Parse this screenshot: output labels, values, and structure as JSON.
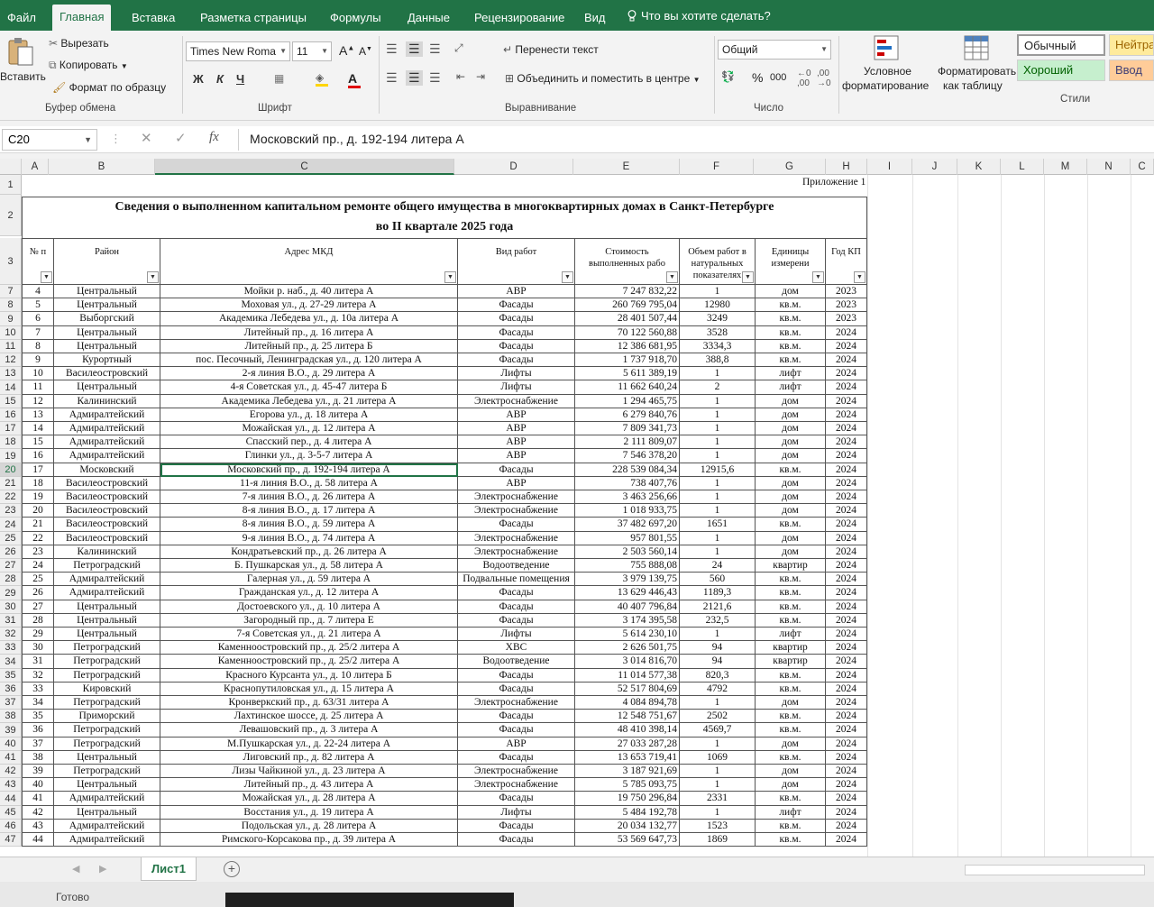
{
  "ribbon_tabs": {
    "file": "Файл",
    "home": "Главная",
    "insert": "Вставка",
    "layout": "Разметка страницы",
    "formulas": "Формулы",
    "data": "Данные",
    "review": "Рецензирование",
    "view": "Вид",
    "tellme": "Что вы хотите сделать?"
  },
  "clipboard": {
    "paste": "Вставить",
    "cut": "Вырезать",
    "copy": "Копировать",
    "format_painter": "Формат по образцу",
    "label": "Буфер обмена"
  },
  "font": {
    "name": "Times New Roma",
    "size": "11",
    "bold": "Ж",
    "italic": "К",
    "underline": "Ч",
    "label": "Шрифт"
  },
  "alignment": {
    "wrap": "Перенести текст",
    "merge": "Объединить и поместить в центре",
    "label": "Выравнивание"
  },
  "number": {
    "format": "Общий",
    "percent": "%",
    "thousands": "000",
    "label": "Число"
  },
  "styles": {
    "conditional": "Условное",
    "conditional2": "форматирование",
    "as_table": "Форматировать",
    "as_table2": "как таблицу",
    "normal": "Обычный",
    "neutral": "Нейтра",
    "good": "Хороший",
    "input": "Ввод",
    "label": "Стили"
  },
  "formula_bar": {
    "cell_ref": "C20",
    "fx": "fx",
    "value": "Московский пр., д. 192-194 литера А"
  },
  "columns": [
    "A",
    "B",
    "C",
    "D",
    "E",
    "F",
    "G",
    "H",
    "I",
    "J",
    "K",
    "L",
    "M",
    "N",
    "C"
  ],
  "sheet": {
    "appendix": "Приложение 1",
    "title_line1": "Сведения о выполненном капитальном ремонте общего имущества в многоквартирных домах в Санкт-Петербурге",
    "title_line2": "во II квартале 2025 года",
    "headers": {
      "num": "№ п",
      "district": "Район",
      "address": "Адрес МКД",
      "work": "Вид работ",
      "cost": "Стоимость выполненных рабо",
      "volume": "Объем работ в натуральных показателях",
      "units": "Единицы измерени",
      "year": "Год КП"
    },
    "rows": [
      {
        "r": "7",
        "n": "4",
        "district": "Центральный",
        "address": "Мойки р. наб., д. 40 литера А",
        "work": "АВР",
        "cost": "7 247 832,22",
        "volume": "1",
        "unit": "дом",
        "year": "2023"
      },
      {
        "r": "8",
        "n": "5",
        "district": "Центральный",
        "address": "Моховая ул., д. 27-29 литера А",
        "work": "Фасады",
        "cost": "260 769 795,04",
        "volume": "12980",
        "unit": "кв.м.",
        "year": "2023"
      },
      {
        "r": "9",
        "n": "6",
        "district": "Выборгский",
        "address": "Академика Лебедева ул., д. 10а литера А",
        "work": "Фасады",
        "cost": "28 401 507,44",
        "volume": "3249",
        "unit": "кв.м.",
        "year": "2023"
      },
      {
        "r": "10",
        "n": "7",
        "district": "Центральный",
        "address": "Литейный пр., д. 16 литера А",
        "work": "Фасады",
        "cost": "70 122 560,88",
        "volume": "3528",
        "unit": "кв.м.",
        "year": "2024"
      },
      {
        "r": "11",
        "n": "8",
        "district": "Центральный",
        "address": "Литейный пр., д. 25 литера Б",
        "work": "Фасады",
        "cost": "12 386 681,95",
        "volume": "3334,3",
        "unit": "кв.м.",
        "year": "2024"
      },
      {
        "r": "12",
        "n": "9",
        "district": "Курортный",
        "address": "пос. Песочный, Ленинградская ул., д. 120 литера А",
        "work": "Фасады",
        "cost": "1 737 918,70",
        "volume": "388,8",
        "unit": "кв.м.",
        "year": "2024"
      },
      {
        "r": "13",
        "n": "10",
        "district": "Василеостровский",
        "address": "2-я линия В.О., д. 29 литера А",
        "work": "Лифты",
        "cost": "5 611 389,19",
        "volume": "1",
        "unit": "лифт",
        "year": "2024"
      },
      {
        "r": "14",
        "n": "11",
        "district": "Центральный",
        "address": "4-я Советская ул., д. 45-47 литера Б",
        "work": "Лифты",
        "cost": "11 662 640,24",
        "volume": "2",
        "unit": "лифт",
        "year": "2024"
      },
      {
        "r": "15",
        "n": "12",
        "district": "Калининский",
        "address": "Академика Лебедева ул., д. 21 литера А",
        "work": "Электроснабжение",
        "cost": "1 294 465,75",
        "volume": "1",
        "unit": "дом",
        "year": "2024"
      },
      {
        "r": "16",
        "n": "13",
        "district": "Адмиралтейский",
        "address": "Егорова ул., д. 18 литера А",
        "work": "АВР",
        "cost": "6 279 840,76",
        "volume": "1",
        "unit": "дом",
        "year": "2024"
      },
      {
        "r": "17",
        "n": "14",
        "district": "Адмиралтейский",
        "address": "Можайская ул., д. 12 литера А",
        "work": "АВР",
        "cost": "7 809 341,73",
        "volume": "1",
        "unit": "дом",
        "year": "2024"
      },
      {
        "r": "18",
        "n": "15",
        "district": "Адмиралтейский",
        "address": "Спасский пер., д. 4 литера А",
        "work": "АВР",
        "cost": "2 111 809,07",
        "volume": "1",
        "unit": "дом",
        "year": "2024"
      },
      {
        "r": "19",
        "n": "16",
        "district": "Адмиралтейский",
        "address": "Глинки ул., д. 3-5-7 литера А",
        "work": "АВР",
        "cost": "7 546 378,20",
        "volume": "1",
        "unit": "дом",
        "year": "2024"
      },
      {
        "r": "20",
        "n": "17",
        "district": "Московский",
        "address": "Московский пр., д. 192-194 литера А",
        "work": "Фасады",
        "cost": "228 539 084,34",
        "volume": "12915,6",
        "unit": "кв.м.",
        "year": "2024"
      },
      {
        "r": "21",
        "n": "18",
        "district": "Василеостровский",
        "address": "11-я линия В.О., д. 58 литера А",
        "work": "АВР",
        "cost": "738 407,76",
        "volume": "1",
        "unit": "дом",
        "year": "2024"
      },
      {
        "r": "22",
        "n": "19",
        "district": "Василеостровский",
        "address": "7-я линия В.О., д. 26 литера А",
        "work": "Электроснабжение",
        "cost": "3 463 256,66",
        "volume": "1",
        "unit": "дом",
        "year": "2024"
      },
      {
        "r": "23",
        "n": "20",
        "district": "Василеостровский",
        "address": "8-я линия В.О., д. 17 литера А",
        "work": "Электроснабжение",
        "cost": "1 018 933,75",
        "volume": "1",
        "unit": "дом",
        "year": "2024"
      },
      {
        "r": "24",
        "n": "21",
        "district": "Василеостровский",
        "address": "8-я линия В.О., д. 59 литера А",
        "work": "Фасады",
        "cost": "37 482 697,20",
        "volume": "1651",
        "unit": "кв.м.",
        "year": "2024"
      },
      {
        "r": "25",
        "n": "22",
        "district": "Василеостровский",
        "address": "9-я линия В.О., д. 74 литера А",
        "work": "Электроснабжение",
        "cost": "957 801,55",
        "volume": "1",
        "unit": "дом",
        "year": "2024"
      },
      {
        "r": "26",
        "n": "23",
        "district": "Калининский",
        "address": "Кондратьевский пр., д. 26 литера А",
        "work": "Электроснабжение",
        "cost": "2 503 560,14",
        "volume": "1",
        "unit": "дом",
        "year": "2024"
      },
      {
        "r": "27",
        "n": "24",
        "district": "Петроградский",
        "address": "Б. Пушкарская ул., д. 58 литера А",
        "work": "Водоотведение",
        "cost": "755 888,08",
        "volume": "24",
        "unit": "квартир",
        "year": "2024"
      },
      {
        "r": "28",
        "n": "25",
        "district": "Адмиралтейский",
        "address": "Галерная ул., д. 59 литера А",
        "work": "Подвальные помещения",
        "cost": "3 979 139,75",
        "volume": "560",
        "unit": "кв.м.",
        "year": "2024"
      },
      {
        "r": "29",
        "n": "26",
        "district": "Адмиралтейский",
        "address": "Гражданская ул., д. 12 литера А",
        "work": "Фасады",
        "cost": "13 629 446,43",
        "volume": "1189,3",
        "unit": "кв.м.",
        "year": "2024"
      },
      {
        "r": "30",
        "n": "27",
        "district": "Центральный",
        "address": "Достоевского ул., д. 10 литера А",
        "work": "Фасады",
        "cost": "40 407 796,84",
        "volume": "2121,6",
        "unit": "кв.м.",
        "year": "2024"
      },
      {
        "r": "31",
        "n": "28",
        "district": "Центральный",
        "address": "Загородный пр., д. 7 литера Е",
        "work": "Фасады",
        "cost": "3 174 395,58",
        "volume": "232,5",
        "unit": "кв.м.",
        "year": "2024"
      },
      {
        "r": "32",
        "n": "29",
        "district": "Центральный",
        "address": "7-я Советская ул., д. 21 литера А",
        "work": "Лифты",
        "cost": "5 614 230,10",
        "volume": "1",
        "unit": "лифт",
        "year": "2024"
      },
      {
        "r": "33",
        "n": "30",
        "district": "Петроградский",
        "address": "Каменноостровский пр., д. 25/2 литера А",
        "work": "ХВС",
        "cost": "2 626 501,75",
        "volume": "94",
        "unit": "квартир",
        "year": "2024"
      },
      {
        "r": "34",
        "n": "31",
        "district": "Петроградский",
        "address": "Каменноостровский пр., д. 25/2 литера А",
        "work": "Водоотведение",
        "cost": "3 014 816,70",
        "volume": "94",
        "unit": "квартир",
        "year": "2024"
      },
      {
        "r": "35",
        "n": "32",
        "district": "Петроградский",
        "address": "Красного Курсанта ул., д. 10 литера Б",
        "work": "Фасады",
        "cost": "11 014 577,38",
        "volume": "820,3",
        "unit": "кв.м.",
        "year": "2024"
      },
      {
        "r": "36",
        "n": "33",
        "district": "Кировский",
        "address": "Краснопутиловская ул., д. 15 литера А",
        "work": "Фасады",
        "cost": "52 517 804,69",
        "volume": "4792",
        "unit": "кв.м.",
        "year": "2024"
      },
      {
        "r": "37",
        "n": "34",
        "district": "Петроградский",
        "address": "Кронверкский пр., д. 63/31 литера А",
        "work": "Электроснабжение",
        "cost": "4 084 894,78",
        "volume": "1",
        "unit": "дом",
        "year": "2024"
      },
      {
        "r": "38",
        "n": "35",
        "district": "Приморский",
        "address": "Лахтинское шоссе, д. 25 литера А",
        "work": "Фасады",
        "cost": "12 548 751,67",
        "volume": "2502",
        "unit": "кв.м.",
        "year": "2024"
      },
      {
        "r": "39",
        "n": "36",
        "district": "Петроградский",
        "address": "Левашовский пр., д. 3 литера А",
        "work": "Фасады",
        "cost": "48 410 398,14",
        "volume": "4569,7",
        "unit": "кв.м.",
        "year": "2024"
      },
      {
        "r": "40",
        "n": "37",
        "district": "Петроградский",
        "address": "М.Пушкарская ул., д. 22-24 литера А",
        "work": "АВР",
        "cost": "27 033 287,28",
        "volume": "1",
        "unit": "дом",
        "year": "2024"
      },
      {
        "r": "41",
        "n": "38",
        "district": "Центральный",
        "address": "Лиговский пр., д. 82 литера А",
        "work": "Фасады",
        "cost": "13 653 719,41",
        "volume": "1069",
        "unit": "кв.м.",
        "year": "2024"
      },
      {
        "r": "42",
        "n": "39",
        "district": "Петроградский",
        "address": "Лизы Чайкиной ул., д. 23 литера А",
        "work": "Электроснабжение",
        "cost": "3 187 921,69",
        "volume": "1",
        "unit": "дом",
        "year": "2024"
      },
      {
        "r": "43",
        "n": "40",
        "district": "Центральный",
        "address": "Литейный пр., д. 43 литера А",
        "work": "Электроснабжение",
        "cost": "5 785 093,75",
        "volume": "1",
        "unit": "дом",
        "year": "2024"
      },
      {
        "r": "44",
        "n": "41",
        "district": "Адмиралтейский",
        "address": "Можайская ул., д. 28 литера А",
        "work": "Фасады",
        "cost": "19 750 296,84",
        "volume": "2331",
        "unit": "кв.м.",
        "year": "2024"
      },
      {
        "r": "45",
        "n": "42",
        "district": "Центральный",
        "address": "Восстания ул., д. 19 литера А",
        "work": "Лифты",
        "cost": "5 484 192,78",
        "volume": "1",
        "unit": "лифт",
        "year": "2024"
      },
      {
        "r": "46",
        "n": "43",
        "district": "Адмиралтейский",
        "address": "Подольская ул., д. 28 литера А",
        "work": "Фасады",
        "cost": "20 034 132,77",
        "volume": "1523",
        "unit": "кв.м.",
        "year": "2024"
      },
      {
        "r": "47",
        "n": "44",
        "district": "Адмиралтейский",
        "address": "Римского-Корсакова пр., д. 39 литера А",
        "work": "Фасады",
        "cost": "53 569 647,73",
        "volume": "1869",
        "unit": "кв.м.",
        "year": "2024"
      }
    ]
  },
  "sheet_tabs": {
    "active": "Лист1",
    "add": "+"
  },
  "status": {
    "text": "Готово"
  },
  "colors": {
    "accent": "#217346",
    "good_fill": "#c6efce",
    "good_text": "#006100",
    "neutral_fill": "#ffeb9c",
    "input_fill": "#ffcc99"
  }
}
